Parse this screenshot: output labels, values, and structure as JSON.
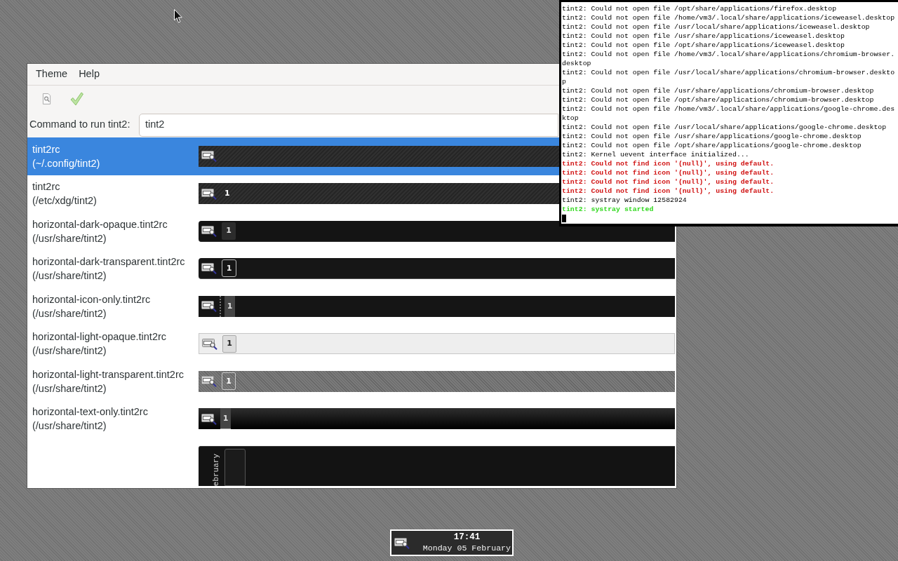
{
  "main_window": {
    "menu": [
      "Theme",
      "Help"
    ],
    "command": {
      "label": "Command to run tint2:",
      "value": "tint2"
    },
    "themes": [
      {
        "name": "tint2rc",
        "path": "(~/.config/tint2)",
        "selected": true,
        "preview": {
          "kind": "dark-textured"
        }
      },
      {
        "name": "tint2rc",
        "path": "(/etc/xdg/tint2)",
        "selected": false,
        "preview": {
          "kind": "dark-textured",
          "desktop": "1"
        }
      },
      {
        "name": "horizontal-dark-opaque.tint2rc",
        "path": "(/usr/share/tint2)",
        "selected": false,
        "preview": {
          "kind": "dark-opaque",
          "desktop": "1"
        }
      },
      {
        "name": "horizontal-dark-transparent.tint2rc",
        "path": "(/usr/share/tint2)",
        "selected": false,
        "preview": {
          "kind": "dark-transparent",
          "desktop": "1"
        }
      },
      {
        "name": "horizontal-icon-only.tint2rc",
        "path": "(/usr/share/tint2)",
        "selected": false,
        "preview": {
          "kind": "icon-only",
          "desktop": "1"
        }
      },
      {
        "name": "horizontal-light-opaque.tint2rc",
        "path": "(/usr/share/tint2)",
        "selected": false,
        "preview": {
          "kind": "light-opaque",
          "desktop": "1"
        }
      },
      {
        "name": "horizontal-light-transparent.tint2rc",
        "path": "(/usr/share/tint2)",
        "selected": false,
        "preview": {
          "kind": "light-transparent",
          "desktop": "1"
        }
      },
      {
        "name": "horizontal-text-only.tint2rc",
        "path": "(/usr/share/tint2)",
        "selected": false,
        "preview": {
          "kind": "text-only",
          "desktop": "1"
        }
      },
      {
        "selected": false,
        "preview": {
          "kind": "vertical",
          "clock": "ebruary"
        }
      }
    ]
  },
  "terminal": {
    "lines": [
      {
        "kind": "normal",
        "text": "tint2: Could not open file /opt/share/applications/firefox.desktop"
      },
      {
        "kind": "normal",
        "text": "tint2: Could not open file /home/vm3/.local/share/applications/iceweasel.desktop"
      },
      {
        "kind": "normal",
        "text": "tint2: Could not open file /usr/local/share/applications/iceweasel.desktop"
      },
      {
        "kind": "normal",
        "text": "tint2: Could not open file /usr/share/applications/iceweasel.desktop"
      },
      {
        "kind": "normal",
        "text": "tint2: Could not open file /opt/share/applications/iceweasel.desktop"
      },
      {
        "kind": "normal",
        "text": "tint2: Could not open file /home/vm3/.local/share/applications/chromium-browser."
      },
      {
        "kind": "normal",
        "text": "desktop"
      },
      {
        "kind": "normal",
        "text": "tint2: Could not open file /usr/local/share/applications/chromium-browser.deskto"
      },
      {
        "kind": "normal",
        "text": "p"
      },
      {
        "kind": "normal",
        "text": "tint2: Could not open file /usr/share/applications/chromium-browser.desktop"
      },
      {
        "kind": "normal",
        "text": "tint2: Could not open file /opt/share/applications/chromium-browser.desktop"
      },
      {
        "kind": "normal",
        "text": "tint2: Could not open file /home/vm3/.local/share/applications/google-chrome.des"
      },
      {
        "kind": "normal",
        "text": "ktop"
      },
      {
        "kind": "normal",
        "text": "tint2: Could not open file /usr/local/share/applications/google-chrome.desktop"
      },
      {
        "kind": "normal",
        "text": "tint2: Could not open file /usr/share/applications/google-chrome.desktop"
      },
      {
        "kind": "normal",
        "text": "tint2: Could not open file /opt/share/applications/google-chrome.desktop"
      },
      {
        "kind": "normal",
        "text": "tint2: Kernel uevent interface initialized..."
      },
      {
        "kind": "error",
        "text": "tint2: Could not find icon '(null)', using default."
      },
      {
        "kind": "error",
        "text": "tint2: Could not find icon '(null)', using default."
      },
      {
        "kind": "error",
        "text": "tint2: Could not find icon '(null)', using default."
      },
      {
        "kind": "error",
        "text": "tint2: Could not find icon '(null)', using default."
      },
      {
        "kind": "normal",
        "text": "tint2: systray window 12582924"
      },
      {
        "kind": "success",
        "text": "tint2: systray started"
      }
    ]
  },
  "clock_panel": {
    "time": "17:41",
    "date": "Monday 05 February"
  }
}
